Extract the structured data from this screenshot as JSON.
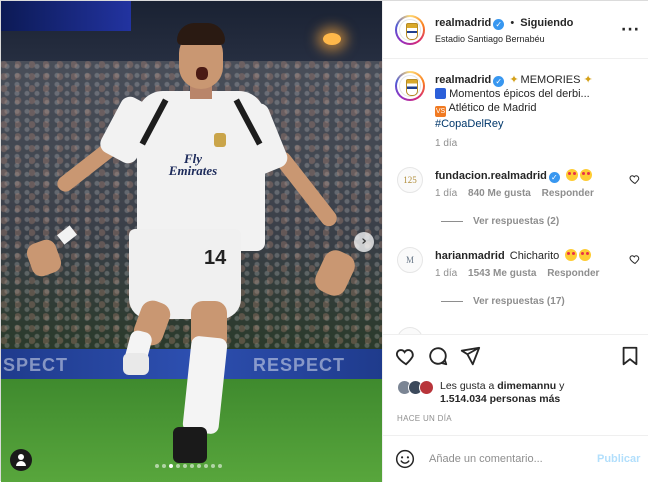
{
  "post": {
    "account": "realmadrid",
    "follow_separator": "•",
    "follow_state": "Siguiendo",
    "location": "Estadio Santiago Bernabéu",
    "more_icon": "more-horizontal-icon"
  },
  "photo": {
    "board_text_left": "SPECT",
    "board_text_right": "RESPECT",
    "shirt_sponsor_line1": "Fly",
    "shirt_sponsor_line2": "Emirates",
    "shirt_number": "14",
    "carousel_slides": 10,
    "carousel_active": 3
  },
  "caption": {
    "author": "realmadrid",
    "title": "MEMORIES",
    "line2": "Momentos épicos del derbi...",
    "line3": "Atlético de Madrid",
    "hashtag": "#CopaDelRey",
    "flag1_label": "Blue flag emoji",
    "flag2_label": "VS",
    "time": "1 día"
  },
  "comments": [
    {
      "author": "fundacion.realmadrid",
      "avatar_text": "125",
      "text": "",
      "time": "1 día",
      "likes": "840 Me gusta",
      "reply": "Responder",
      "view_replies": "Ver respuestas (2)"
    },
    {
      "author": "harianmadrid",
      "avatar_text": "M",
      "text": "Chicharito",
      "time": "1 día",
      "likes": "1543 Me gusta",
      "reply": "Responder",
      "view_replies": "Ver respuestas (17)"
    }
  ],
  "stats": {
    "liked_by_prefix": "Les gusta a",
    "liked_by_user": "dimemannu",
    "liked_by_suffix": "y",
    "others": "1.514.034 personas más",
    "timestamp": "HACE UN DÍA"
  },
  "composer": {
    "placeholder": "Añade un comentario...",
    "publish": "Publicar"
  },
  "colors": {
    "link": "#00376b",
    "verified": "#3897f0",
    "publish": "#b2dffc",
    "muted": "#8e8e8e"
  }
}
